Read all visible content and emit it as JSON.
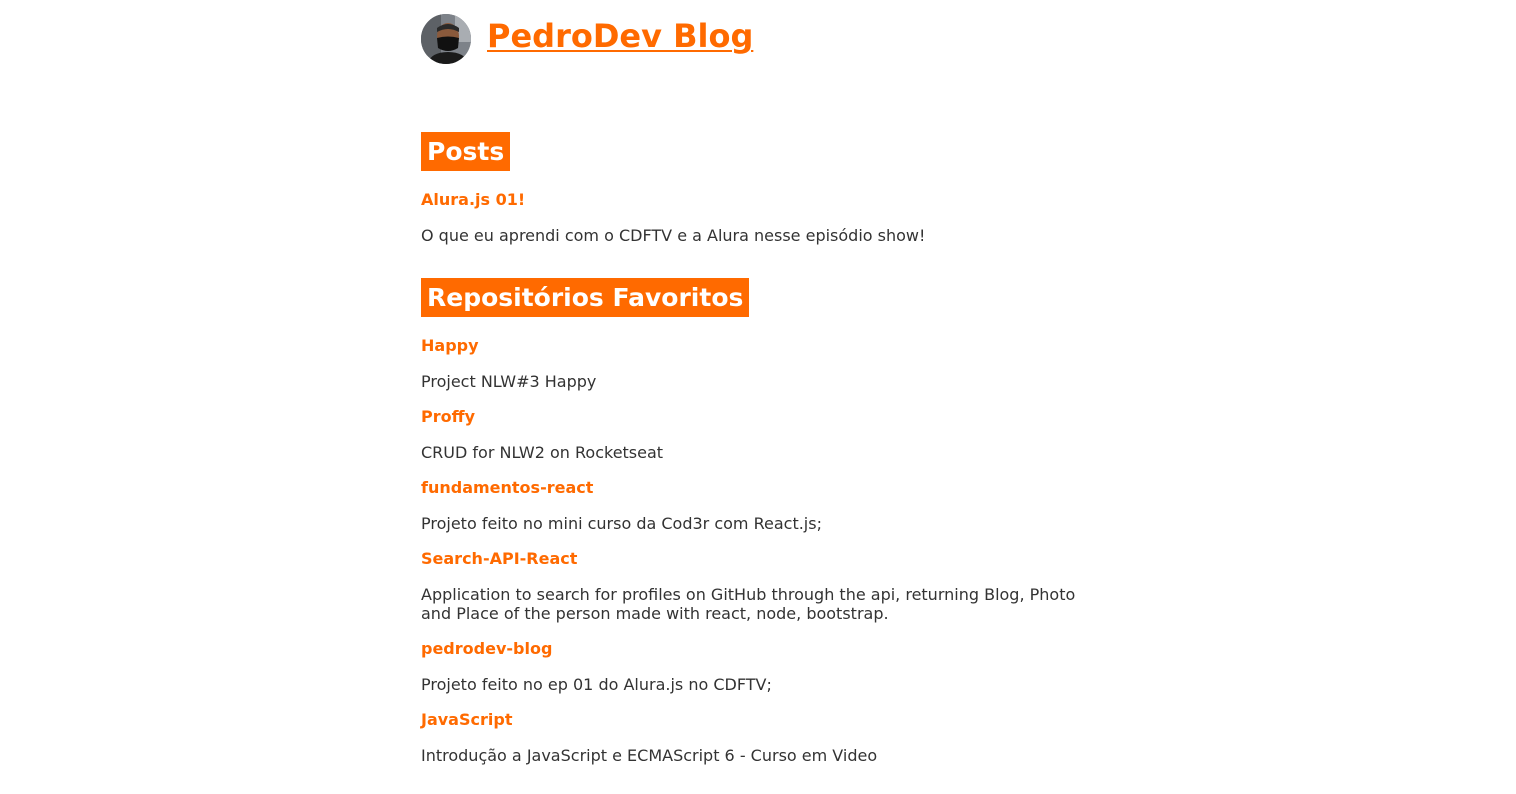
{
  "header": {
    "title": "PedroDev Blog",
    "avatar_icon": "profile-photo"
  },
  "accent_color": "#ff6a00",
  "posts": {
    "heading": "Posts",
    "items": [
      {
        "title": "Alura.js 01!",
        "description": "O que eu aprendi com o CDFTV e a Alura nesse episódio show!"
      }
    ]
  },
  "repos": {
    "heading": "Repositórios Favoritos",
    "items": [
      {
        "title": "Happy",
        "description": "Project NLW#3 Happy"
      },
      {
        "title": "Proffy",
        "description": "CRUD for NLW2 on Rocketseat"
      },
      {
        "title": "fundamentos-react",
        "description": "Projeto feito no mini curso da Cod3r com React.js;"
      },
      {
        "title": "Search-API-React",
        "description": "Application to search for profiles on GitHub through the api, returning Blog, Photo and Place of the person made with react, node, bootstrap."
      },
      {
        "title": "pedrodev-blog",
        "description": "Projeto feito no ep 01 do Alura.js no CDFTV;"
      },
      {
        "title": "JavaScript",
        "description": "Introdução a JavaScript e ECMAScript 6 - Curso em Video"
      }
    ]
  }
}
